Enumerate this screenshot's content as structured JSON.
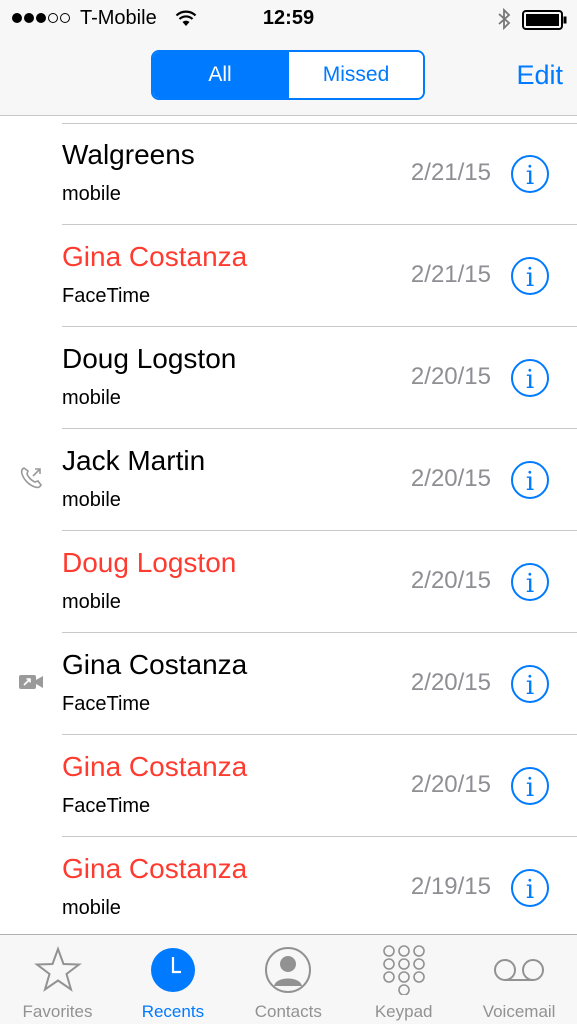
{
  "status": {
    "carrier": "T-Mobile",
    "time": "12:59",
    "signal_full": 3,
    "signal_total": 5
  },
  "nav": {
    "segments": [
      {
        "label": "All",
        "active": true
      },
      {
        "label": "Missed",
        "active": false
      }
    ],
    "edit_label": "Edit"
  },
  "calls": [
    {
      "name": "Walgreens",
      "type": "mobile",
      "date": "2/21/15",
      "missed": false,
      "indicator": "none"
    },
    {
      "name": "Gina Costanza",
      "type": "FaceTime",
      "date": "2/21/15",
      "missed": true,
      "indicator": "none"
    },
    {
      "name": "Doug Logston",
      "type": "mobile",
      "date": "2/20/15",
      "missed": false,
      "indicator": "none"
    },
    {
      "name": "Jack Martin",
      "type": "mobile",
      "date": "2/20/15",
      "missed": false,
      "indicator": "outgoing-phone"
    },
    {
      "name": "Doug Logston",
      "type": "mobile",
      "date": "2/20/15",
      "missed": true,
      "indicator": "none"
    },
    {
      "name": "Gina Costanza",
      "type": "FaceTime",
      "date": "2/20/15",
      "missed": false,
      "indicator": "outgoing-video"
    },
    {
      "name": "Gina Costanza",
      "type": "FaceTime",
      "date": "2/20/15",
      "missed": true,
      "indicator": "none"
    },
    {
      "name": "Gina Costanza",
      "type": "mobile",
      "date": "2/19/15",
      "missed": true,
      "indicator": "none"
    }
  ],
  "tabs": [
    {
      "label": "Favorites",
      "icon": "star-icon",
      "active": false
    },
    {
      "label": "Recents",
      "icon": "clock-icon",
      "active": true
    },
    {
      "label": "Contacts",
      "icon": "person-icon",
      "active": false
    },
    {
      "label": "Keypad",
      "icon": "keypad-icon",
      "active": false
    },
    {
      "label": "Voicemail",
      "icon": "voicemail-icon",
      "active": false
    }
  ],
  "colors": {
    "accent": "#007aff",
    "missed": "#ff3b30",
    "secondary_text": "#8e8e93",
    "inactive_tab": "#929292"
  }
}
